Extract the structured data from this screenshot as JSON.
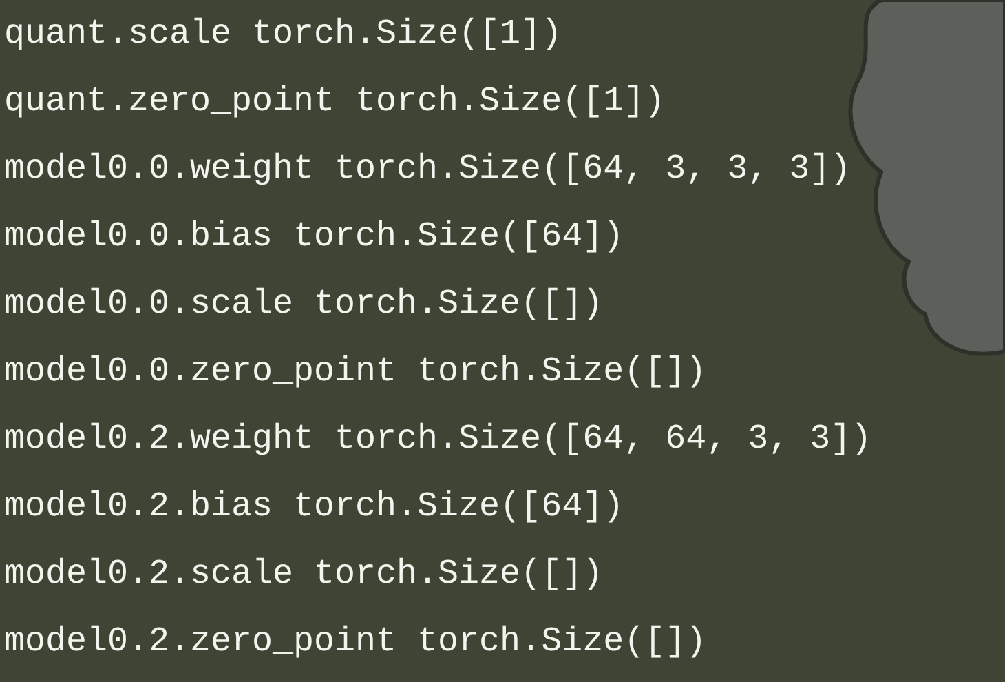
{
  "terminal": {
    "lines": [
      "quant.scale torch.Size([1])",
      "quant.zero_point torch.Size([1])",
      "model0.0.weight torch.Size([64, 3, 3, 3])",
      "model0.0.bias torch.Size([64])",
      "model0.0.scale torch.Size([])",
      "model0.0.zero_point torch.Size([])",
      "model0.2.weight torch.Size([64, 64, 3, 3])",
      "model0.2.bias torch.Size([64])",
      "model0.2.scale torch.Size([])",
      "model0.2.zero_point torch.Size([])"
    ]
  }
}
